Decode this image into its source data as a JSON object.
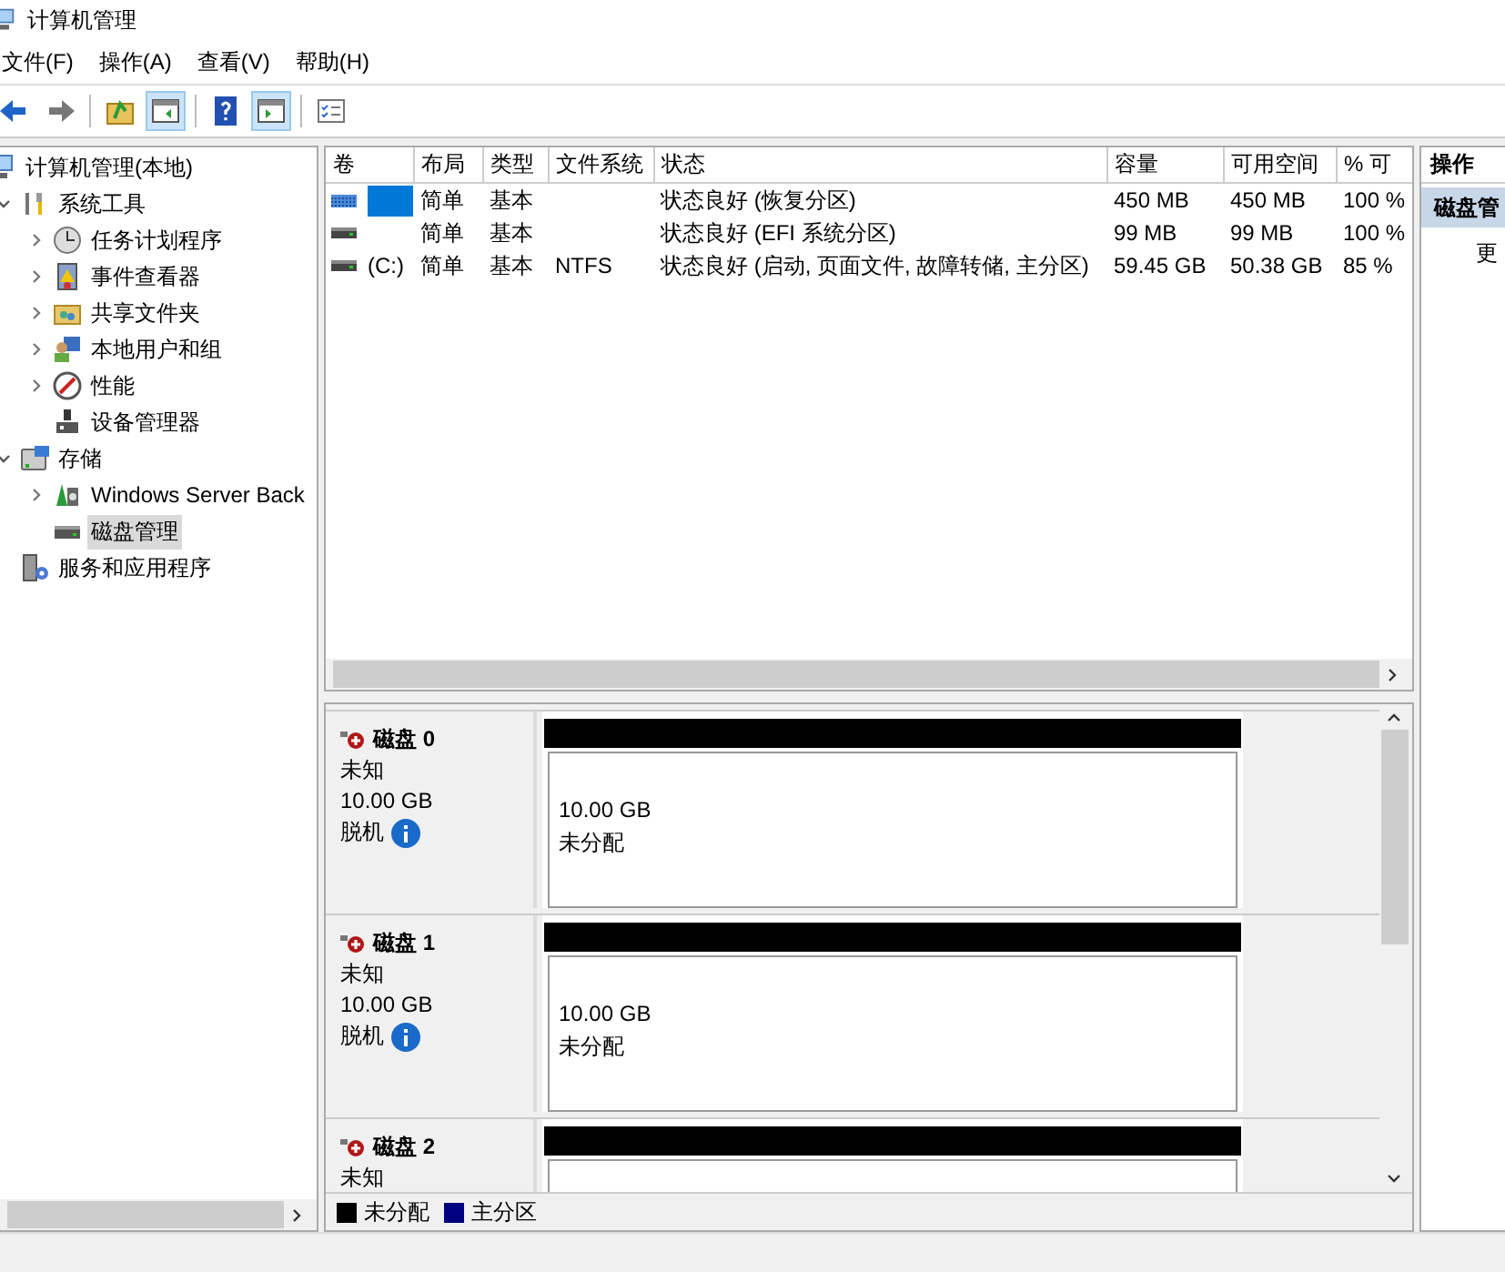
{
  "window": {
    "title": "计算机管理"
  },
  "menu": [
    "文件(F)",
    "操作(A)",
    "查看(V)",
    "帮助(H)"
  ],
  "toolbar": [
    {
      "kind": "back",
      "pressed": false
    },
    {
      "kind": "forward",
      "pressed": false
    },
    {
      "kind": "up",
      "pressed": false
    },
    {
      "kind": "tree",
      "pressed": true
    },
    {
      "kind": "help",
      "pressed": false
    },
    {
      "kind": "pane",
      "pressed": true
    },
    {
      "kind": "props",
      "pressed": false
    }
  ],
  "tree": [
    {
      "label": "计算机管理(本地)",
      "kind": "computer",
      "selected": false,
      "children": [
        {
          "label": "系统工具",
          "kind": "tools",
          "expanded": true,
          "selected": false,
          "children": [
            {
              "label": "任务计划程序",
              "kind": "clock",
              "expanded": false,
              "selected": false
            },
            {
              "label": "事件查看器",
              "kind": "event",
              "expanded": false,
              "selected": false
            },
            {
              "label": "共享文件夹",
              "kind": "share",
              "expanded": false,
              "selected": false
            },
            {
              "label": "本地用户和组",
              "kind": "users",
              "expanded": false,
              "selected": false
            },
            {
              "label": "性能",
              "kind": "perf",
              "expanded": false,
              "selected": false
            },
            {
              "label": "设备管理器",
              "kind": "device",
              "selected": false
            }
          ]
        },
        {
          "label": "存储",
          "kind": "storage",
          "expanded": true,
          "selected": false,
          "children": [
            {
              "label": "Windows Server Back",
              "kind": "backup",
              "expanded": false,
              "selected": false
            },
            {
              "label": "磁盘管理",
              "kind": "disk",
              "selected": true
            }
          ]
        },
        {
          "label": "服务和应用程序",
          "kind": "services",
          "selected": false
        }
      ]
    }
  ],
  "volumes": {
    "columns": [
      "卷",
      "布局",
      "类型",
      "文件系统",
      "状态",
      "容量",
      "可用空间",
      "% 可"
    ],
    "rows": [
      {
        "kind": "recovery",
        "selected": true,
        "cells": [
          "",
          "简单",
          "基本",
          "",
          "状态良好 (恢复分区)",
          "450 MB",
          "450 MB",
          "100 %"
        ]
      },
      {
        "kind": "basic",
        "selected": false,
        "cells": [
          "",
          "简单",
          "基本",
          "",
          "状态良好 (EFI 系统分区)",
          "99 MB",
          "99 MB",
          "100 %"
        ]
      },
      {
        "kind": "basic",
        "selected": false,
        "cells": [
          "(C:)",
          "简单",
          "基本",
          "NTFS",
          "状态良好 (启动, 页面文件, 故障转储, 主分区)",
          "59.45 GB",
          "50.38 GB",
          "85 %"
        ]
      }
    ]
  },
  "disks": [
    {
      "name": "磁盘 0",
      "type": "未知",
      "size": "10.00 GB",
      "status": "脱机",
      "partition": {
        "color": "#000000",
        "size": "10.00 GB",
        "label": "未分配"
      }
    },
    {
      "name": "磁盘 1",
      "type": "未知",
      "size": "10.00 GB",
      "status": "脱机",
      "partition": {
        "color": "#000000",
        "size": "10.00 GB",
        "label": "未分配"
      }
    },
    {
      "name": "磁盘 2",
      "type": "未知",
      "partition": {
        "color": "#000000"
      }
    }
  ],
  "legend": [
    {
      "label": "未分配",
      "color": "#000000"
    },
    {
      "label": "主分区",
      "color": "#000080"
    }
  ],
  "actions": {
    "title": "操作",
    "items": [
      {
        "kind": "header",
        "label": "磁盘管"
      },
      {
        "kind": "link",
        "label": "更"
      }
    ]
  }
}
